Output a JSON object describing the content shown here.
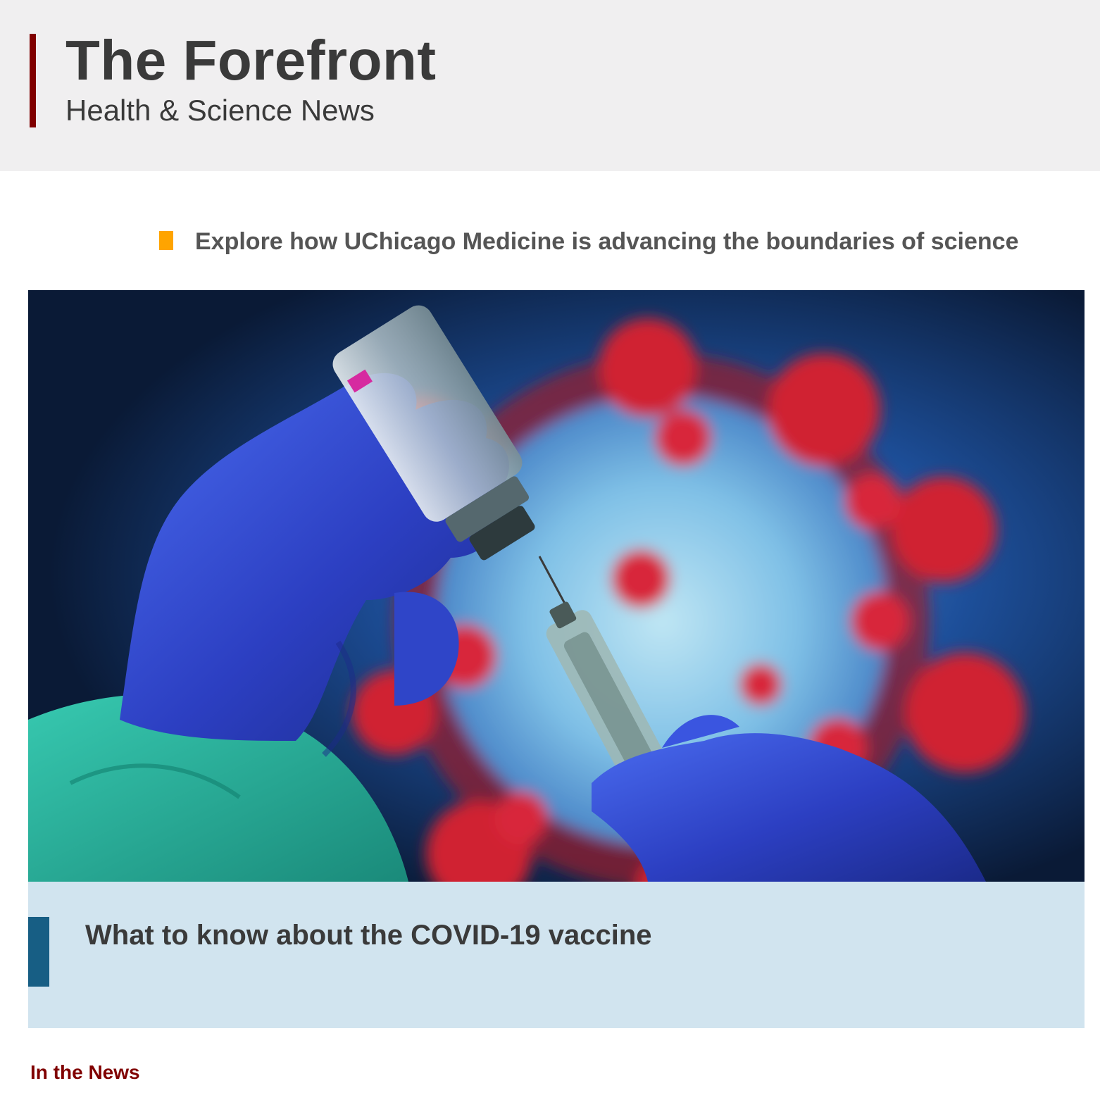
{
  "header": {
    "title": "The Forefront",
    "subtitle": "Health & Science News"
  },
  "tagline": {
    "text": "Explore how UChicago Medicine is advancing the boundaries of science"
  },
  "feature": {
    "image_subject": "gloved hands filling a syringe from a vaccine vial in front of a coronavirus illustration",
    "title": "What to know about the COVID-19 vaccine"
  },
  "section": {
    "label": "In the News"
  },
  "colors": {
    "brand_maroon": "#800000",
    "tag_marker": "#ffa400",
    "caption_bg": "#d1e4ef",
    "caption_accent": "#175e84",
    "header_bg": "#f0eff0"
  }
}
